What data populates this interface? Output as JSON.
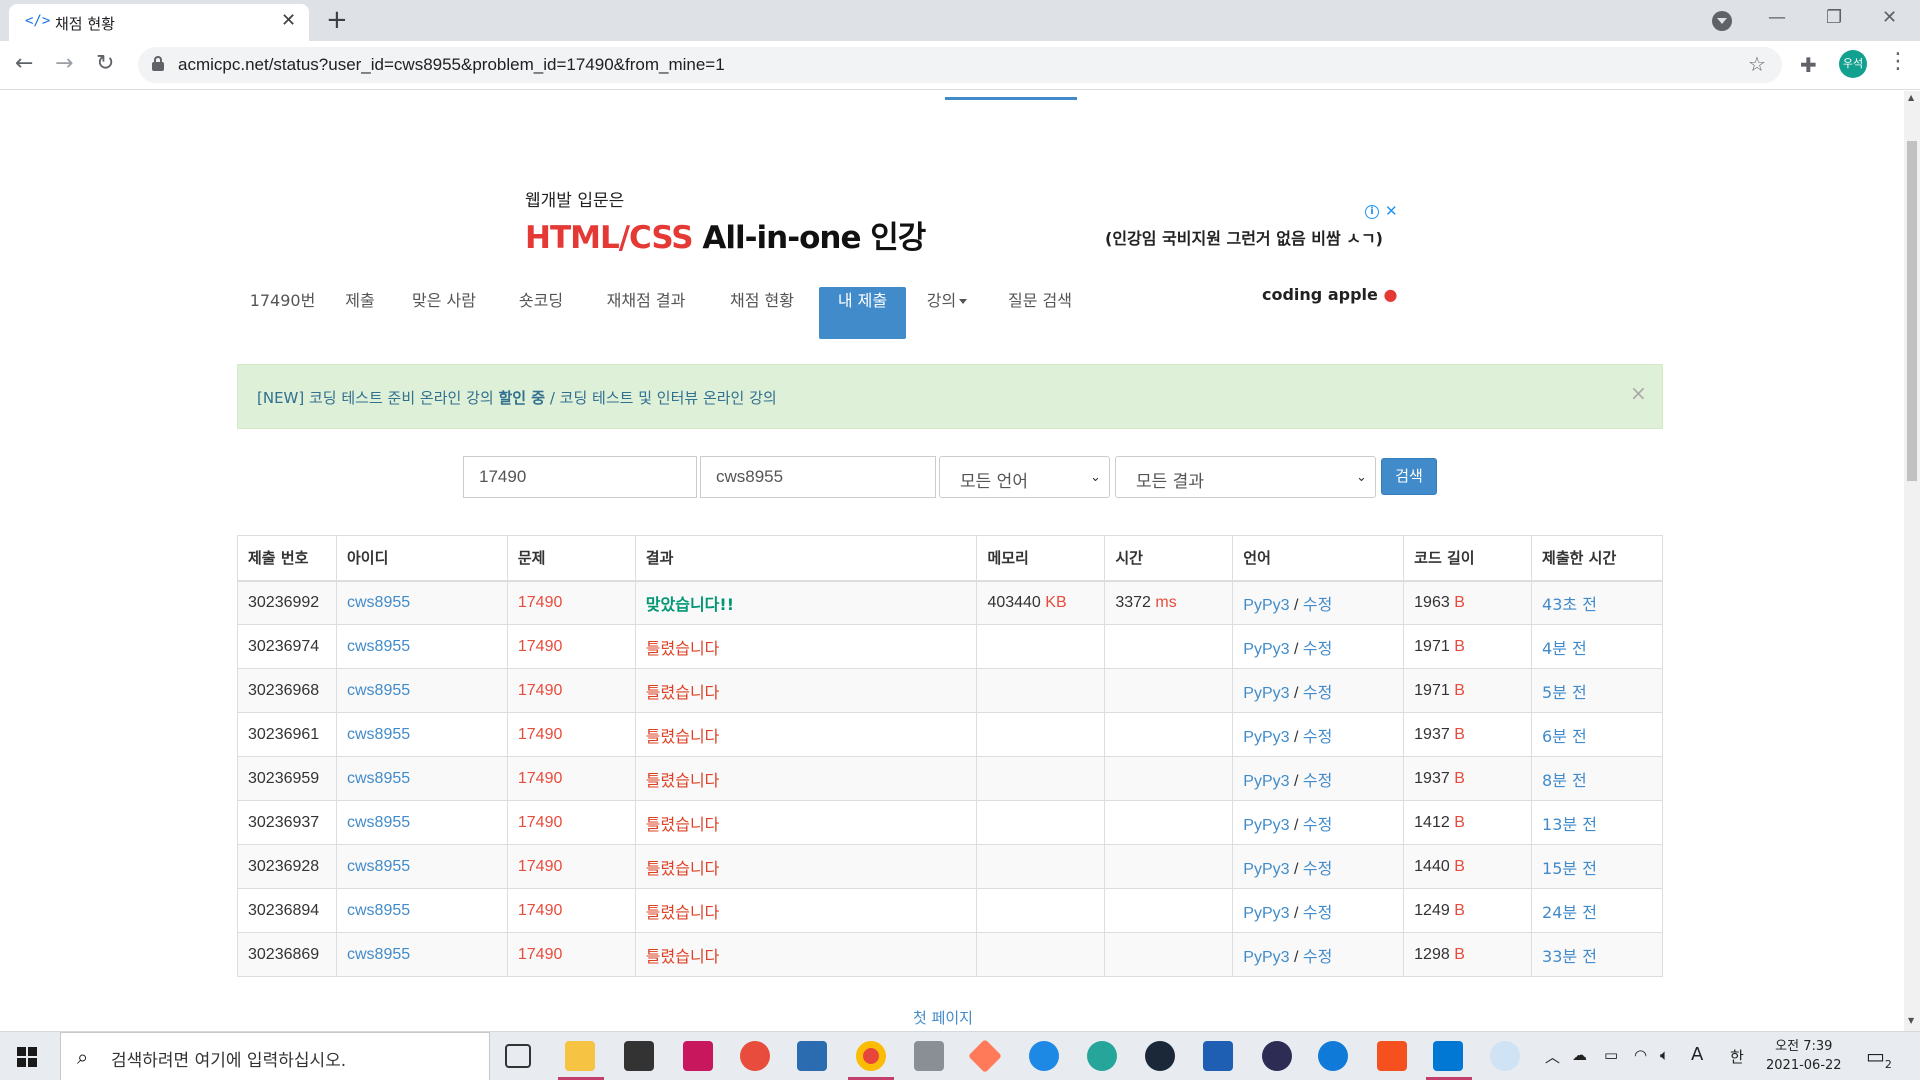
{
  "browser": {
    "tab_title": "채점 현황",
    "tab_favicon": "</>",
    "url": "acmicpc.net/status?user_id=cws8955&problem_id=17490&from_mine=1",
    "profile_initials": "우석"
  },
  "ad": {
    "subtitle": "웹개발 입문은",
    "title_red": "HTML/CSS",
    "title_black": " All-in-one 인강",
    "right_text": "(인강임 국비지원 그런거 없음 비쌈 ㅅㄱ)",
    "brand": "coding apple"
  },
  "problem_nav": {
    "items": [
      "17490번",
      "제출",
      "맞은 사람",
      "숏코딩",
      "재채점 결과",
      "채점 현황",
      "내 제출",
      "강의",
      "질문 검색"
    ],
    "active": "내 제출"
  },
  "alert": {
    "prefix": "[NEW] 코딩 테스트 준비 온라인 강의 ",
    "bold": "할인 중",
    "suffix": " / 코딩 테스트 및 인터뷰 온라인 강의",
    "close": "×"
  },
  "search_form": {
    "problem_id": "17490",
    "user_id": "cws8955",
    "language": "모든 언어",
    "result": "모든 결과",
    "button": "검색"
  },
  "table": {
    "headers": [
      "제출 번호",
      "아이디",
      "문제",
      "결과",
      "메모리",
      "시간",
      "언어",
      "코드 길이",
      "제출한 시간"
    ],
    "rows": [
      {
        "id": "30236992",
        "user": "cws8955",
        "problem": "17490",
        "result": "맞았습니다!!",
        "accepted": true,
        "memory": "403440",
        "memory_unit": "KB",
        "time": "3372",
        "time_unit": "ms",
        "lang": "PyPy3",
        "edit": "수정",
        "len": "1963",
        "len_unit": "B",
        "ago": "43초 전"
      },
      {
        "id": "30236974",
        "user": "cws8955",
        "problem": "17490",
        "result": "틀렸습니다",
        "accepted": false,
        "memory": "",
        "memory_unit": "",
        "time": "",
        "time_unit": "",
        "lang": "PyPy3",
        "edit": "수정",
        "len": "1971",
        "len_unit": "B",
        "ago": "4분 전"
      },
      {
        "id": "30236968",
        "user": "cws8955",
        "problem": "17490",
        "result": "틀렸습니다",
        "accepted": false,
        "memory": "",
        "memory_unit": "",
        "time": "",
        "time_unit": "",
        "lang": "PyPy3",
        "edit": "수정",
        "len": "1971",
        "len_unit": "B",
        "ago": "5분 전"
      },
      {
        "id": "30236961",
        "user": "cws8955",
        "problem": "17490",
        "result": "틀렸습니다",
        "accepted": false,
        "memory": "",
        "memory_unit": "",
        "time": "",
        "time_unit": "",
        "lang": "PyPy3",
        "edit": "수정",
        "len": "1937",
        "len_unit": "B",
        "ago": "6분 전"
      },
      {
        "id": "30236959",
        "user": "cws8955",
        "problem": "17490",
        "result": "틀렸습니다",
        "accepted": false,
        "memory": "",
        "memory_unit": "",
        "time": "",
        "time_unit": "",
        "lang": "PyPy3",
        "edit": "수정",
        "len": "1937",
        "len_unit": "B",
        "ago": "8분 전"
      },
      {
        "id": "30236937",
        "user": "cws8955",
        "problem": "17490",
        "result": "틀렸습니다",
        "accepted": false,
        "memory": "",
        "memory_unit": "",
        "time": "",
        "time_unit": "",
        "lang": "PyPy3",
        "edit": "수정",
        "len": "1412",
        "len_unit": "B",
        "ago": "13분 전"
      },
      {
        "id": "30236928",
        "user": "cws8955",
        "problem": "17490",
        "result": "틀렸습니다",
        "accepted": false,
        "memory": "",
        "memory_unit": "",
        "time": "",
        "time_unit": "",
        "lang": "PyPy3",
        "edit": "수정",
        "len": "1440",
        "len_unit": "B",
        "ago": "15분 전"
      },
      {
        "id": "30236894",
        "user": "cws8955",
        "problem": "17490",
        "result": "틀렸습니다",
        "accepted": false,
        "memory": "",
        "memory_unit": "",
        "time": "",
        "time_unit": "",
        "lang": "PyPy3",
        "edit": "수정",
        "len": "1249",
        "len_unit": "B",
        "ago": "24분 전"
      },
      {
        "id": "30236869",
        "user": "cws8955",
        "problem": "17490",
        "result": "틀렸습니다",
        "accepted": false,
        "memory": "",
        "memory_unit": "",
        "time": "",
        "time_unit": "",
        "lang": "PyPy3",
        "edit": "수정",
        "len": "1298",
        "len_unit": "B",
        "ago": "33분 전"
      }
    ]
  },
  "pagination": {
    "first_page": "첫 페이지"
  },
  "taskbar": {
    "search_placeholder": "검색하려면 여기에 입력하십시오.",
    "ime": "한",
    "font_indicator": "A",
    "time": "오전 7:39",
    "date": "2021-06-22",
    "notification_count": "2"
  },
  "colors": {
    "accent": "#428bca",
    "accepted": "#009874",
    "wrong": "#dd4124",
    "alert_bg": "#dff0d8"
  }
}
